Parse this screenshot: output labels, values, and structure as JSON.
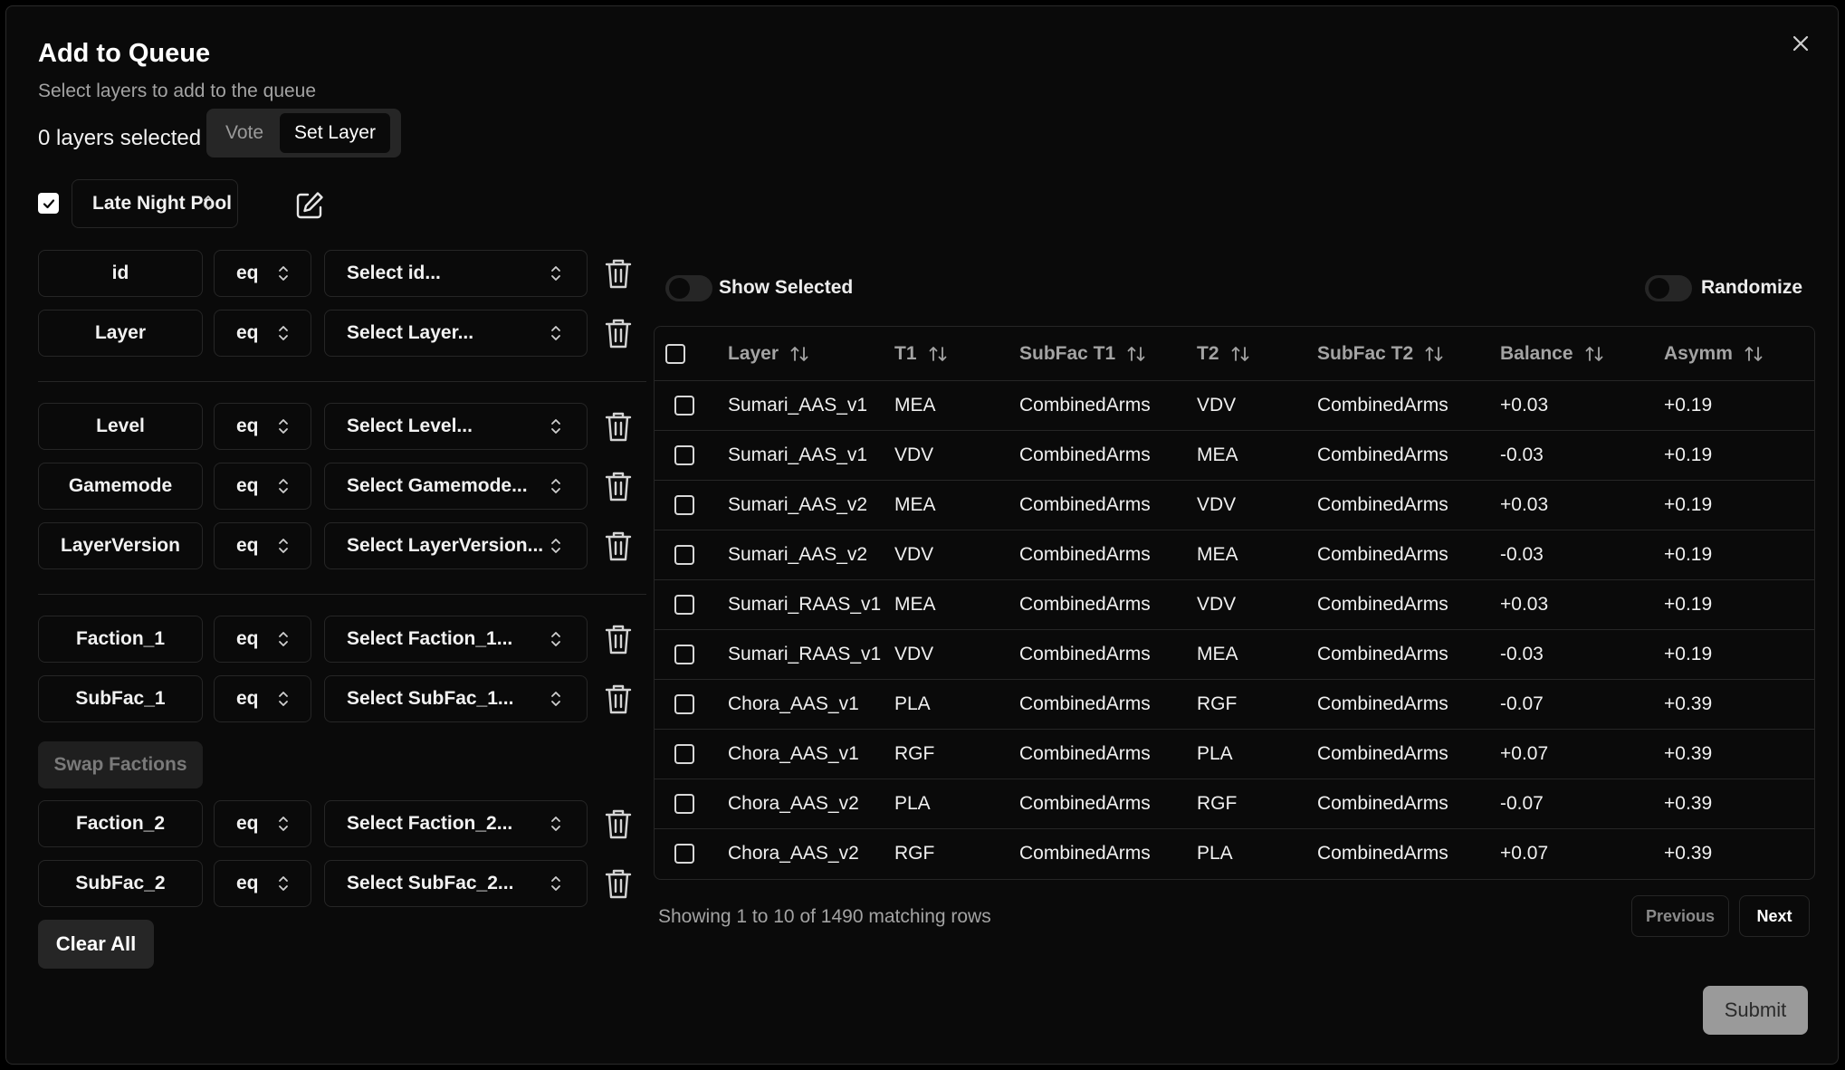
{
  "dialog": {
    "title": "Add to Queue",
    "subtitle": "Select layers to add to the queue",
    "close_icon": "close-icon"
  },
  "selection": {
    "count_label": "0 layers selected",
    "modes": [
      {
        "label": "Vote",
        "active": false
      },
      {
        "label": "Set Layer",
        "active": true
      }
    ]
  },
  "pool": {
    "checked": true,
    "selected": "Late Night Pool",
    "edit_icon": "edit-icon"
  },
  "filters": [
    {
      "field": "id",
      "op": "eq",
      "placeholder": "Select id..."
    },
    {
      "field": "Layer",
      "op": "eq",
      "placeholder": "Select Layer..."
    },
    {
      "field": "Level",
      "op": "eq",
      "placeholder": "Select Level..."
    },
    {
      "field": "Gamemode",
      "op": "eq",
      "placeholder": "Select Gamemode..."
    },
    {
      "field": "LayerVersion",
      "op": "eq",
      "placeholder": "Select LayerVersion..."
    },
    {
      "field": "Faction_1",
      "op": "eq",
      "placeholder": "Select Faction_1..."
    },
    {
      "field": "SubFac_1",
      "op": "eq",
      "placeholder": "Select SubFac_1..."
    },
    {
      "field": "Faction_2",
      "op": "eq",
      "placeholder": "Select Faction_2..."
    },
    {
      "field": "SubFac_2",
      "op": "eq",
      "placeholder": "Select SubFac_2..."
    }
  ],
  "buttons": {
    "swap_factions": "Swap Factions",
    "clear_all": "Clear All",
    "submit": "Submit",
    "previous": "Previous",
    "next": "Next"
  },
  "toggles": {
    "show_selected": {
      "label": "Show Selected",
      "on": false
    },
    "randomize": {
      "label": "Randomize",
      "on": false
    }
  },
  "table": {
    "columns": [
      "Layer",
      "T1",
      "SubFac T1",
      "T2",
      "SubFac T2",
      "Balance",
      "Asymm"
    ],
    "rows": [
      [
        "Sumari_AAS_v1",
        "MEA",
        "CombinedArms",
        "VDV",
        "CombinedArms",
        "+0.03",
        "+0.19"
      ],
      [
        "Sumari_AAS_v1",
        "VDV",
        "CombinedArms",
        "MEA",
        "CombinedArms",
        "-0.03",
        "+0.19"
      ],
      [
        "Sumari_AAS_v2",
        "MEA",
        "CombinedArms",
        "VDV",
        "CombinedArms",
        "+0.03",
        "+0.19"
      ],
      [
        "Sumari_AAS_v2",
        "VDV",
        "CombinedArms",
        "MEA",
        "CombinedArms",
        "-0.03",
        "+0.19"
      ],
      [
        "Sumari_RAAS_v1",
        "MEA",
        "CombinedArms",
        "VDV",
        "CombinedArms",
        "+0.03",
        "+0.19"
      ],
      [
        "Sumari_RAAS_v1",
        "VDV",
        "CombinedArms",
        "MEA",
        "CombinedArms",
        "-0.03",
        "+0.19"
      ],
      [
        "Chora_AAS_v1",
        "PLA",
        "CombinedArms",
        "RGF",
        "CombinedArms",
        "-0.07",
        "+0.39"
      ],
      [
        "Chora_AAS_v1",
        "RGF",
        "CombinedArms",
        "PLA",
        "CombinedArms",
        "+0.07",
        "+0.39"
      ],
      [
        "Chora_AAS_v2",
        "PLA",
        "CombinedArms",
        "RGF",
        "CombinedArms",
        "-0.07",
        "+0.39"
      ],
      [
        "Chora_AAS_v2",
        "RGF",
        "CombinedArms",
        "PLA",
        "CombinedArms",
        "+0.07",
        "+0.39"
      ]
    ],
    "footer": "Showing 1 to 10 of 1490 matching rows"
  }
}
